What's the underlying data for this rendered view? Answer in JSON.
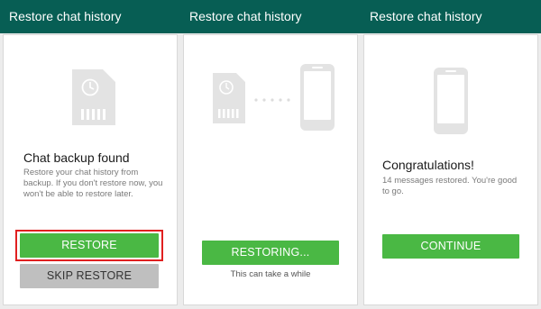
{
  "colors": {
    "header_bg": "#075e54",
    "accent_green": "#4ab844",
    "skip_gray": "#bfbfbf",
    "highlight_red": "#e02020",
    "icon_gray": "#e3e3e3"
  },
  "panels": [
    {
      "header": "Restore chat history",
      "icon": "sd-card-clock-icon",
      "title": "Chat backup found",
      "description": "Restore your chat history from backup. If you don't restore now, you won't be able to restore later.",
      "primary_button": "RESTORE",
      "secondary_button": "SKIP RESTORE"
    },
    {
      "header": "Restore chat history",
      "icon": "sd-card-to-phone-icon",
      "primary_button": "RESTORING...",
      "note": "This can take a while"
    },
    {
      "header": "Restore chat history",
      "icon": "phone-icon",
      "title": "Congratulations!",
      "description": "14 messages restored. You're good to go.",
      "primary_button": "CONTINUE"
    }
  ]
}
